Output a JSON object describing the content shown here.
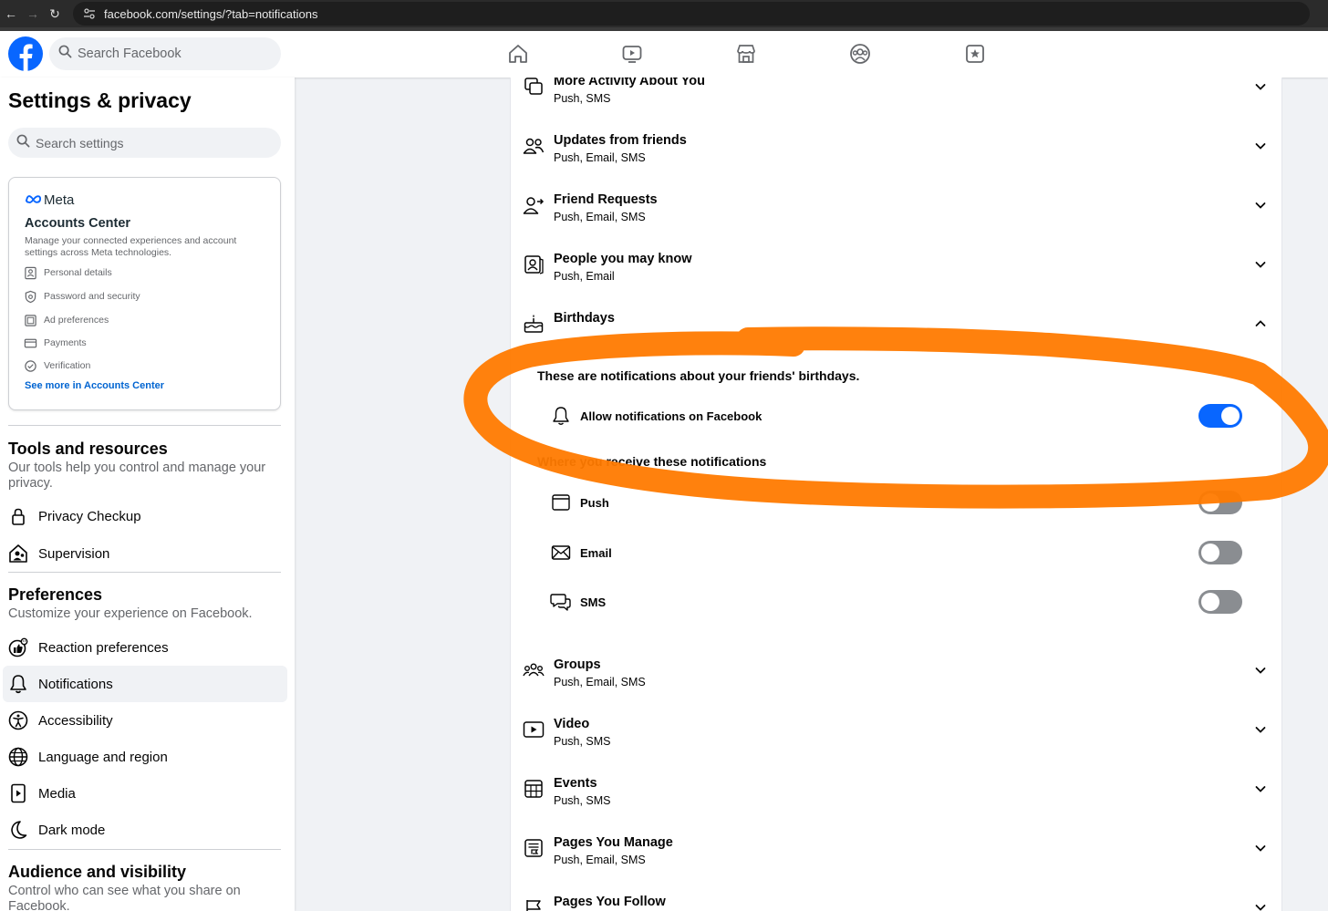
{
  "browser": {
    "url": "facebook.com/settings/?tab=notifications"
  },
  "topbar": {
    "search_placeholder": "Search Facebook",
    "nav_icons": [
      "home-icon",
      "video-icon",
      "marketplace-icon",
      "groups-icon",
      "gaming-icon"
    ]
  },
  "sidebar": {
    "title": "Settings & privacy",
    "search_placeholder": "Search settings",
    "accounts_center": {
      "brand": "Meta",
      "title": "Accounts Center",
      "description": "Manage your connected experiences and account settings across Meta technologies.",
      "items": [
        {
          "label": "Personal details",
          "icon": "id-card-icon"
        },
        {
          "label": "Password and security",
          "icon": "shield-icon"
        },
        {
          "label": "Ad preferences",
          "icon": "ad-preferences-icon"
        },
        {
          "label": "Payments",
          "icon": "credit-card-icon"
        },
        {
          "label": "Verification",
          "icon": "verified-badge-icon"
        }
      ],
      "link": "See more in Accounts Center"
    },
    "tools": {
      "title": "Tools and resources",
      "subtitle": "Our tools help you control and manage your privacy.",
      "items": [
        {
          "label": "Privacy Checkup",
          "icon": "lock-icon"
        },
        {
          "label": "Supervision",
          "icon": "supervision-icon"
        }
      ]
    },
    "preferences": {
      "title": "Preferences",
      "subtitle": "Customize your experience on Facebook.",
      "items": [
        {
          "label": "Reaction preferences",
          "icon": "reactions-icon"
        },
        {
          "label": "Notifications",
          "icon": "bell-icon",
          "active": true
        },
        {
          "label": "Accessibility",
          "icon": "accessibility-icon"
        },
        {
          "label": "Language and region",
          "icon": "globe-icon"
        },
        {
          "label": "Media",
          "icon": "media-icon"
        },
        {
          "label": "Dark mode",
          "icon": "moon-icon"
        }
      ]
    },
    "audience": {
      "title": "Audience and visibility",
      "subtitle": "Control who can see what you share on Facebook."
    }
  },
  "notifications": {
    "rows_top": [
      {
        "title": "More Activity About You",
        "channels": "Push, SMS",
        "icon": "activity-icon"
      },
      {
        "title": "Updates from friends",
        "channels": "Push, Email, SMS",
        "icon": "friends-icon"
      },
      {
        "title": "Friend Requests",
        "channels": "Push, Email, SMS",
        "icon": "friend-request-icon"
      },
      {
        "title": "People you may know",
        "channels": "Push, Email",
        "icon": "people-you-may-know-icon"
      },
      {
        "title": "Birthdays",
        "channels": "",
        "icon": "cake-icon"
      }
    ],
    "birthdays_expanded": {
      "description": "These are notifications about your friends' birthdays.",
      "allow_label": "Allow notifications on Facebook",
      "allow_on": true,
      "where_title": "Where you receive these notifications",
      "channels": [
        {
          "label": "Push",
          "icon": "push-icon",
          "on": false
        },
        {
          "label": "Email",
          "icon": "email-icon",
          "on": false
        },
        {
          "label": "SMS",
          "icon": "sms-icon",
          "on": false
        }
      ]
    },
    "rows_bottom": [
      {
        "title": "Groups",
        "channels": "Push, Email, SMS",
        "icon": "groups-icon"
      },
      {
        "title": "Video",
        "channels": "Push, SMS",
        "icon": "video-icon"
      },
      {
        "title": "Events",
        "channels": "Push, SMS",
        "icon": "calendar-icon"
      },
      {
        "title": "Pages You Manage",
        "channels": "Push, Email, SMS",
        "icon": "pages-manage-icon"
      },
      {
        "title": "Pages You Follow",
        "channels": "",
        "icon": "flag-icon"
      }
    ]
  },
  "colors": {
    "brand_blue": "#0866ff",
    "link_blue": "#0064d1",
    "annotation_orange": "#ff7a00",
    "toggle_off": "#8a8d91"
  }
}
